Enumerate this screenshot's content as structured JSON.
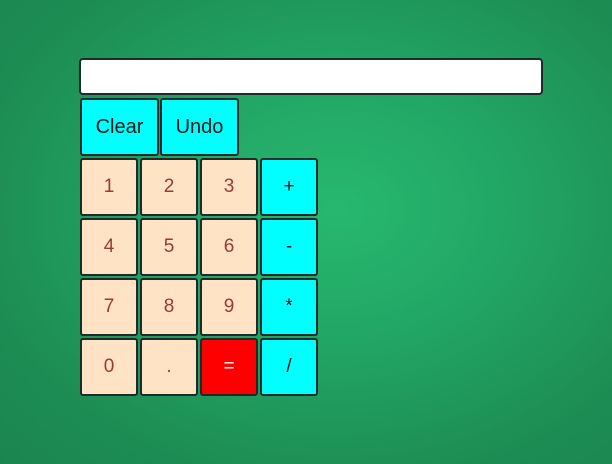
{
  "display": {
    "value": "",
    "placeholder": ""
  },
  "controls": {
    "clear_label": "Clear",
    "undo_label": "Undo"
  },
  "keypad": {
    "one": "1",
    "two": "2",
    "three": "3",
    "four": "4",
    "five": "5",
    "six": "6",
    "seven": "7",
    "eight": "8",
    "nine": "9",
    "zero": "0",
    "decimal": ".",
    "equals": "=",
    "plus": "+",
    "minus": "-",
    "multiply": "*",
    "divide": "/"
  },
  "colors": {
    "background": "#22a765",
    "digit_key": "#ffe3c4",
    "digit_text": "#9a3b32",
    "operator_key": "#00ffff",
    "equals_key": "#ff0000"
  }
}
